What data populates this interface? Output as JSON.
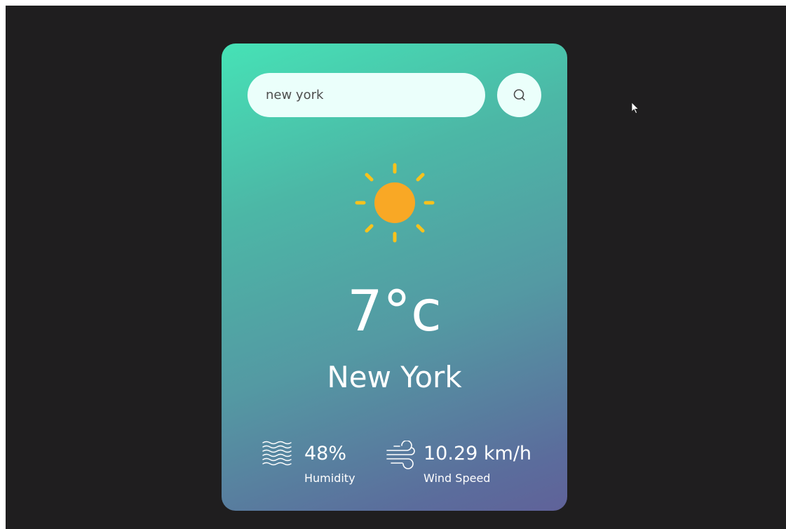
{
  "search": {
    "value": "new york",
    "button_icon": "search-icon"
  },
  "weather": {
    "icon": "sun-icon",
    "temperature": "7°c",
    "city": "New York"
  },
  "details": {
    "humidity": {
      "icon": "humidity-waves-icon",
      "value": "48%",
      "label": "Humidity"
    },
    "wind": {
      "icon": "wind-icon",
      "value": "10.29 km/h",
      "label": "Wind Speed"
    }
  },
  "colors": {
    "screen_background": "#1f1e1f",
    "card_gradient_start": "#46e2b6",
    "card_gradient_end": "#606299",
    "search_background": "#ebfffb",
    "sun_ray": "#f8c21c",
    "sun_core": "#f9a825",
    "text": "#ffffff"
  }
}
